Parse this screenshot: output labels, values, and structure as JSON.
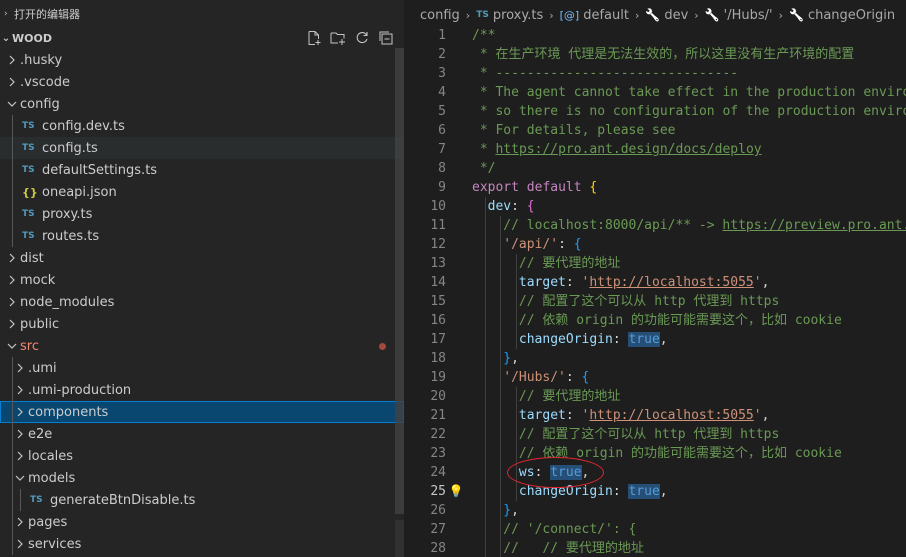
{
  "sidebar": {
    "open_editors_label": "打开的编辑器",
    "root_label": "WOOD",
    "actions": [
      {
        "name": "new-file-icon"
      },
      {
        "name": "new-folder-icon"
      },
      {
        "name": "refresh-icon"
      },
      {
        "name": "collapse-all-icon"
      }
    ],
    "items": [
      {
        "label": ".husky",
        "type": "folder",
        "expanded": false,
        "depth": 0
      },
      {
        "label": ".vscode",
        "type": "folder",
        "expanded": false,
        "depth": 0
      },
      {
        "label": "config",
        "type": "folder",
        "expanded": true,
        "depth": 0
      },
      {
        "label": "config.dev.ts",
        "type": "ts",
        "depth": 1
      },
      {
        "label": "config.ts",
        "type": "ts",
        "depth": 1,
        "state": "hover"
      },
      {
        "label": "defaultSettings.ts",
        "type": "ts",
        "depth": 1
      },
      {
        "label": "oneapi.json",
        "type": "json",
        "depth": 1
      },
      {
        "label": "proxy.ts",
        "type": "ts",
        "depth": 1
      },
      {
        "label": "routes.ts",
        "type": "ts",
        "depth": 1
      },
      {
        "label": "dist",
        "type": "folder",
        "expanded": false,
        "depth": 0
      },
      {
        "label": "mock",
        "type": "folder",
        "expanded": false,
        "depth": 0
      },
      {
        "label": "node_modules",
        "type": "folder",
        "expanded": false,
        "depth": 0
      },
      {
        "label": "public",
        "type": "folder",
        "expanded": false,
        "depth": 0
      },
      {
        "label": "src",
        "type": "folder",
        "expanded": true,
        "depth": 0,
        "modified": true
      },
      {
        "label": ".umi",
        "type": "folder",
        "expanded": false,
        "depth": 1
      },
      {
        "label": ".umi-production",
        "type": "folder",
        "expanded": false,
        "depth": 1
      },
      {
        "label": "components",
        "type": "folder",
        "expanded": false,
        "depth": 1,
        "state": "active"
      },
      {
        "label": "e2e",
        "type": "folder",
        "expanded": false,
        "depth": 1
      },
      {
        "label": "locales",
        "type": "folder",
        "expanded": false,
        "depth": 1
      },
      {
        "label": "models",
        "type": "folder",
        "expanded": true,
        "depth": 1
      },
      {
        "label": "generateBtnDisable.ts",
        "type": "ts",
        "depth": 2
      },
      {
        "label": "pages",
        "type": "folder",
        "expanded": false,
        "depth": 1
      },
      {
        "label": "services",
        "type": "folder",
        "expanded": false,
        "depth": 1
      }
    ]
  },
  "breadcrumbs": {
    "items": [
      {
        "label": "config",
        "icon": ""
      },
      {
        "label": "proxy.ts",
        "icon": "TS"
      },
      {
        "label": "default",
        "icon": "[@]"
      },
      {
        "label": "dev",
        "icon": "wrench"
      },
      {
        "label": "'/Hubs/'",
        "icon": "wrench"
      },
      {
        "label": "changeOrigin",
        "icon": "wrench"
      }
    ]
  },
  "editor": {
    "current_line": 25,
    "lightbulb_line": 25,
    "lines": [
      {
        "n": "1",
        "tokens": [
          [
            "c",
            "/**"
          ]
        ]
      },
      {
        "n": "2",
        "tokens": [
          [
            "c",
            " * 在生产环境 代理是无法生效的，所以这里没有生产环境的配置"
          ]
        ]
      },
      {
        "n": "3",
        "tokens": [
          [
            "c",
            " * -------------------------------"
          ]
        ]
      },
      {
        "n": "4",
        "tokens": [
          [
            "c",
            " * The agent cannot take effect in the production environment"
          ]
        ]
      },
      {
        "n": "5",
        "tokens": [
          [
            "c",
            " * so there is no configuration of the production environment"
          ]
        ]
      },
      {
        "n": "6",
        "tokens": [
          [
            "c",
            " * For details, please see"
          ]
        ]
      },
      {
        "n": "7",
        "tokens": [
          [
            "c",
            " * "
          ],
          [
            "c u",
            "https://pro.ant.design/docs/deploy"
          ]
        ]
      },
      {
        "n": "8",
        "tokens": [
          [
            "c",
            " */"
          ]
        ]
      },
      {
        "n": "9",
        "tokens": [
          [
            "k",
            "export"
          ],
          [
            "w",
            " "
          ],
          [
            "k",
            "default"
          ],
          [
            "w",
            " "
          ],
          [
            "br",
            "{"
          ]
        ]
      },
      {
        "n": "10",
        "indent": 1,
        "tokens": [
          [
            "p",
            "dev"
          ],
          [
            "w",
            ": "
          ],
          [
            "br2",
            "{"
          ]
        ]
      },
      {
        "n": "11",
        "indent": 2,
        "tokens": [
          [
            "c",
            "// localhost:8000/api/** -> "
          ],
          [
            "c u",
            "https://preview.pro.ant.design/api/**"
          ]
        ]
      },
      {
        "n": "12",
        "indent": 2,
        "tokens": [
          [
            "s",
            "'/api/'"
          ],
          [
            "w",
            ": "
          ],
          [
            "br3",
            "{"
          ]
        ]
      },
      {
        "n": "13",
        "indent": 3,
        "tokens": [
          [
            "c",
            "// 要代理的地址"
          ]
        ]
      },
      {
        "n": "14",
        "indent": 3,
        "tokens": [
          [
            "p",
            "target"
          ],
          [
            "w",
            ": "
          ],
          [
            "s",
            "'"
          ],
          [
            "s u",
            "http://localhost:5055"
          ],
          [
            "s",
            "'"
          ],
          [
            "w",
            ","
          ]
        ]
      },
      {
        "n": "15",
        "indent": 3,
        "tokens": [
          [
            "c",
            "// 配置了这个可以从 http 代理到 https"
          ]
        ]
      },
      {
        "n": "16",
        "indent": 3,
        "tokens": [
          [
            "c",
            "// 依赖 origin 的功能可能需要这个，比如 cookie"
          ]
        ]
      },
      {
        "n": "17",
        "indent": 3,
        "tokens": [
          [
            "p",
            "changeOrigin"
          ],
          [
            "w",
            ": "
          ],
          [
            "b hl",
            "true"
          ],
          [
            "w",
            ","
          ]
        ]
      },
      {
        "n": "18",
        "indent": 2,
        "tokens": [
          [
            "br3",
            "}"
          ],
          [
            "w",
            ","
          ]
        ]
      },
      {
        "n": "19",
        "indent": 2,
        "tokens": [
          [
            "s",
            "'/Hubs/'"
          ],
          [
            "w",
            ": "
          ],
          [
            "br3",
            "{"
          ]
        ]
      },
      {
        "n": "20",
        "indent": 3,
        "tokens": [
          [
            "c",
            "// 要代理的地址"
          ]
        ]
      },
      {
        "n": "21",
        "indent": 3,
        "tokens": [
          [
            "p",
            "target"
          ],
          [
            "w",
            ": "
          ],
          [
            "s",
            "'"
          ],
          [
            "s u",
            "http://localhost:5055"
          ],
          [
            "s",
            "'"
          ],
          [
            "w",
            ","
          ]
        ]
      },
      {
        "n": "22",
        "indent": 3,
        "tokens": [
          [
            "c",
            "// 配置了这个可以从 http 代理到 https"
          ]
        ]
      },
      {
        "n": "23",
        "indent": 3,
        "tokens": [
          [
            "c",
            "// 依赖 origin 的功能可能需要这个，比如 cookie"
          ]
        ]
      },
      {
        "n": "24",
        "indent": 3,
        "tokens": [
          [
            "p",
            "ws"
          ],
          [
            "w",
            ": "
          ],
          [
            "b hl",
            "true"
          ],
          [
            "w",
            ","
          ]
        ]
      },
      {
        "n": "25",
        "indent": 3,
        "tokens": [
          [
            "p",
            "changeOrigin"
          ],
          [
            "w",
            ": "
          ],
          [
            "b hl",
            "true"
          ],
          [
            "w",
            ","
          ]
        ]
      },
      {
        "n": "26",
        "indent": 2,
        "tokens": [
          [
            "br3",
            "}"
          ],
          [
            "w",
            ","
          ]
        ]
      },
      {
        "n": "27",
        "indent": 2,
        "tokens": [
          [
            "c",
            "// '/connect/': {"
          ]
        ]
      },
      {
        "n": "28",
        "indent": 2,
        "tokens": [
          [
            "c",
            "//   // 要代理的地址"
          ]
        ]
      }
    ]
  },
  "colors": {
    "annotation": "#e0282e",
    "selection": "#094771",
    "ts_icon": "#519aba",
    "json_icon": "#cbcb41"
  }
}
